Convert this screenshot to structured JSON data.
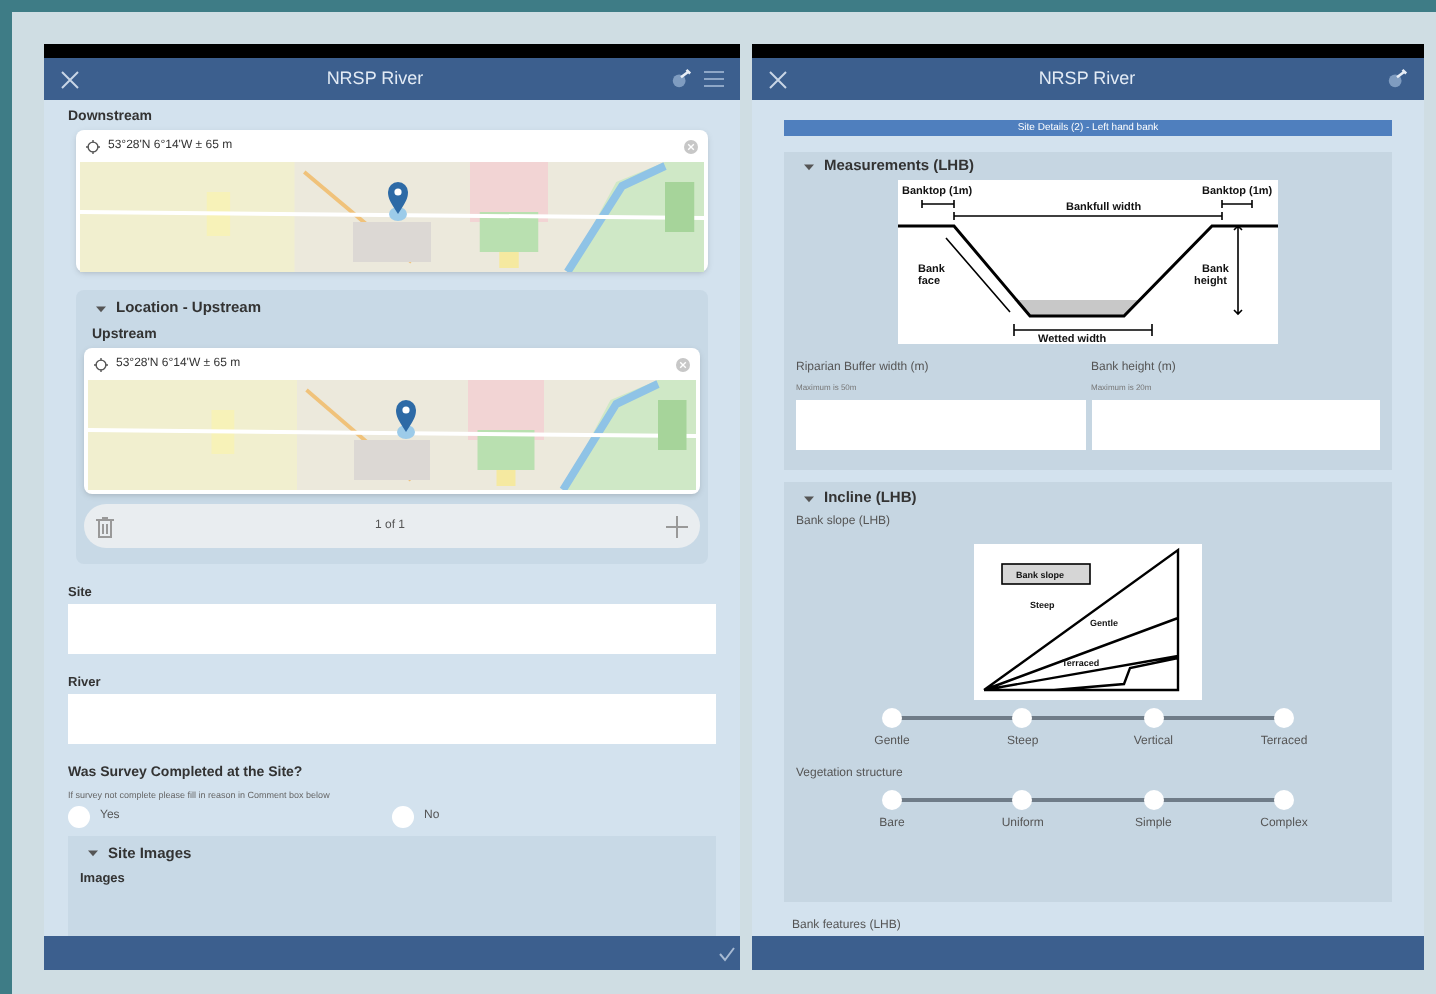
{
  "left_screen": {
    "title": "NRSP River",
    "downstream": {
      "label": "Downstream",
      "coordinates": "53°28'N 6°14'W ± 65 m"
    },
    "upstream_group": {
      "title": "Location - Upstream",
      "expanded": true,
      "label": "Upstream",
      "coordinates": "53°28'N 6°14'W ± 65 m",
      "pager": "1 of 1"
    },
    "fields": [
      {
        "label": "Site"
      },
      {
        "label": "River"
      }
    ],
    "survey_question": {
      "label": "Was Survey Completed at the Site?",
      "hint": "If survey not complete please fill in reason in Comment box below",
      "options": [
        {
          "label": "Yes",
          "selected": false
        },
        {
          "label": "No",
          "selected": false
        }
      ]
    },
    "images_group": {
      "title": "Site Images",
      "expanded": true,
      "label": "Images"
    }
  },
  "right_screen": {
    "title": "NRSP River",
    "banner": "Site Details (2) - Left hand bank",
    "measurements": {
      "title": "Measurements (LHB)",
      "expanded": true,
      "diagram_labels": {
        "banktop_left": "Banktop (1m)",
        "bankfull": "Bankfull width",
        "banktop_right": "Banktop (1m)",
        "bank_face": [
          "Bank",
          "face"
        ],
        "bank_height": [
          "Bank",
          "height"
        ],
        "wetted": "Wetted width"
      },
      "fields": [
        {
          "label": "Riparian Buffer width (m)",
          "hint": "Maximum is 50m"
        },
        {
          "label": "Bank height (m)",
          "hint": "Maximum is 20m"
        }
      ]
    },
    "incline": {
      "title": "Incline (LHB)",
      "expanded": true,
      "slope_label": "Bank slope (LHB)",
      "diagram_labels": {
        "key": "Bank slope",
        "steep": "Steep",
        "gentle": "Gentle",
        "terraced": "Terraced"
      },
      "slope_steps": [
        {
          "label": "Gentle",
          "selected": false
        },
        {
          "label": "Steep",
          "selected": false
        },
        {
          "label": "Vertical",
          "selected": false
        },
        {
          "label": "Terraced",
          "selected": false
        }
      ],
      "vegetation_label": "Vegetation structure",
      "vegetation_steps": [
        {
          "label": "Bare",
          "selected": false
        },
        {
          "label": "Uniform",
          "selected": false
        },
        {
          "label": "Simple",
          "selected": false
        },
        {
          "label": "Complex",
          "selected": false
        }
      ]
    },
    "next_section": "Bank features (LHB)"
  }
}
